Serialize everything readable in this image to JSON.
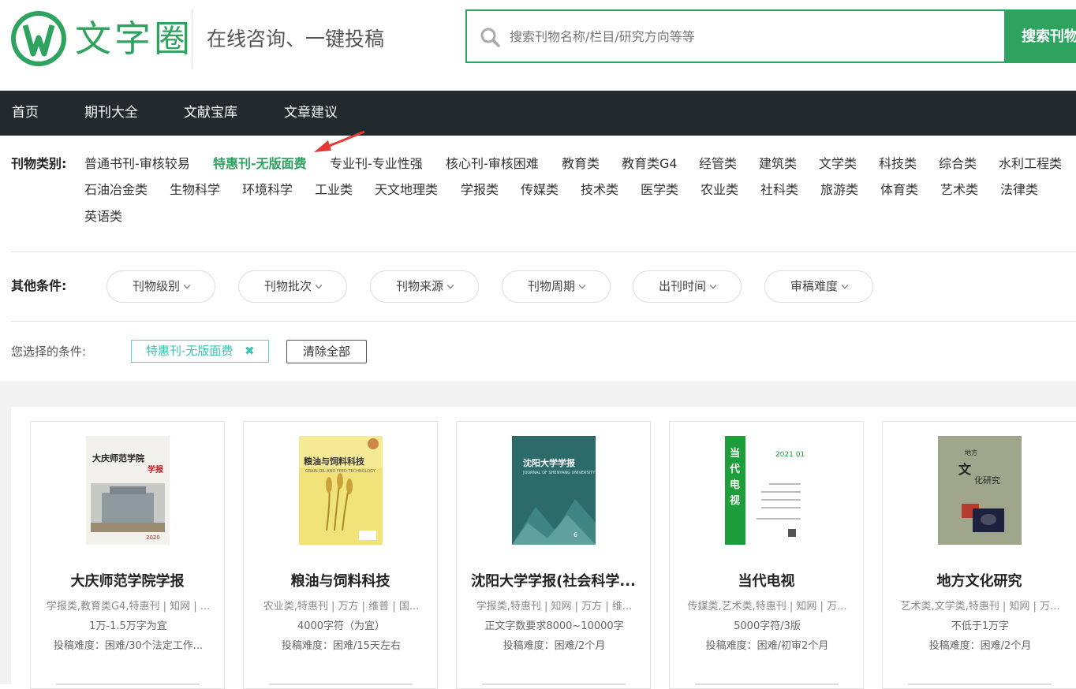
{
  "brand": {
    "name": "文字圈",
    "slogan": "在线咨询、一键投稿",
    "color": "#2ea360"
  },
  "search": {
    "placeholder": "搜索刊物名称/栏目/研究方向等等",
    "button": "搜索刊物"
  },
  "nav": [
    "首页",
    "期刊大全",
    "文献宝库",
    "文章建议"
  ],
  "categories": {
    "label": "刊物类别:",
    "items": [
      "普通书刊-审核较易",
      "特惠刊-无版面费",
      "专业刊-专业性强",
      "核心刊-审核困难",
      "教育类",
      "教育类G4",
      "经管类",
      "建筑类",
      "文学类",
      "科技类",
      "综合类",
      "水利工程类",
      "石油冶金类",
      "生物科学",
      "环境科学",
      "工业类",
      "天文地理类",
      "学报类",
      "传媒类",
      "技术类",
      "医学类",
      "农业类",
      "社科类",
      "旅游类",
      "体育类",
      "艺术类",
      "法律类",
      "英语类"
    ],
    "active": "特惠刊-无版面费"
  },
  "conditions": {
    "label": "其他条件:",
    "filters": [
      "刊物级别",
      "刊物批次",
      "刊物来源",
      "刊物周期",
      "出刊时间",
      "审稿难度"
    ]
  },
  "selected": {
    "label": "您选择的条件:",
    "tag": "特惠刊-无版面费",
    "remove_icon": "✖",
    "clear": "清除全部"
  },
  "journals": [
    {
      "title": "大庆师范学院学报",
      "tags": "学报类,教育类G4,特惠刊 | 知网 | ...",
      "words": "1万-1.5万字为宜",
      "difficulty": "投稿难度：困难/30个法定工作...",
      "cover_title": "大庆师范学院学报"
    },
    {
      "title": "粮油与饲料科技",
      "tags": "农业类,特惠刊 | 万方 | 维普 | 国...",
      "words": "4000字符（为宜）",
      "difficulty": "投稿难度：困难/15天左右",
      "cover_title": "粮油与饲料科技"
    },
    {
      "title": "沈阳大学学报(社会科学...",
      "tags": "学报类,特惠刊 | 知网 | 万方 | 维...",
      "words": "正文字数要求8000~10000字",
      "difficulty": "投稿难度：困难/2个月",
      "cover_title": "沈阳大学学报"
    },
    {
      "title": "当代电视",
      "tags": "传媒类,艺术类,特惠刊 | 知网 | 万...",
      "words": "5000字符/3版",
      "difficulty": "投稿难度：困难/初审2个月",
      "cover_title": "当代电视"
    },
    {
      "title": "地方文化研究",
      "tags": "艺术类,文学类,特惠刊 | 知网 | 万...",
      "words": "不低于1万字",
      "difficulty": "投稿难度：困难/2个月",
      "cover_title": "地方文化研究"
    }
  ]
}
